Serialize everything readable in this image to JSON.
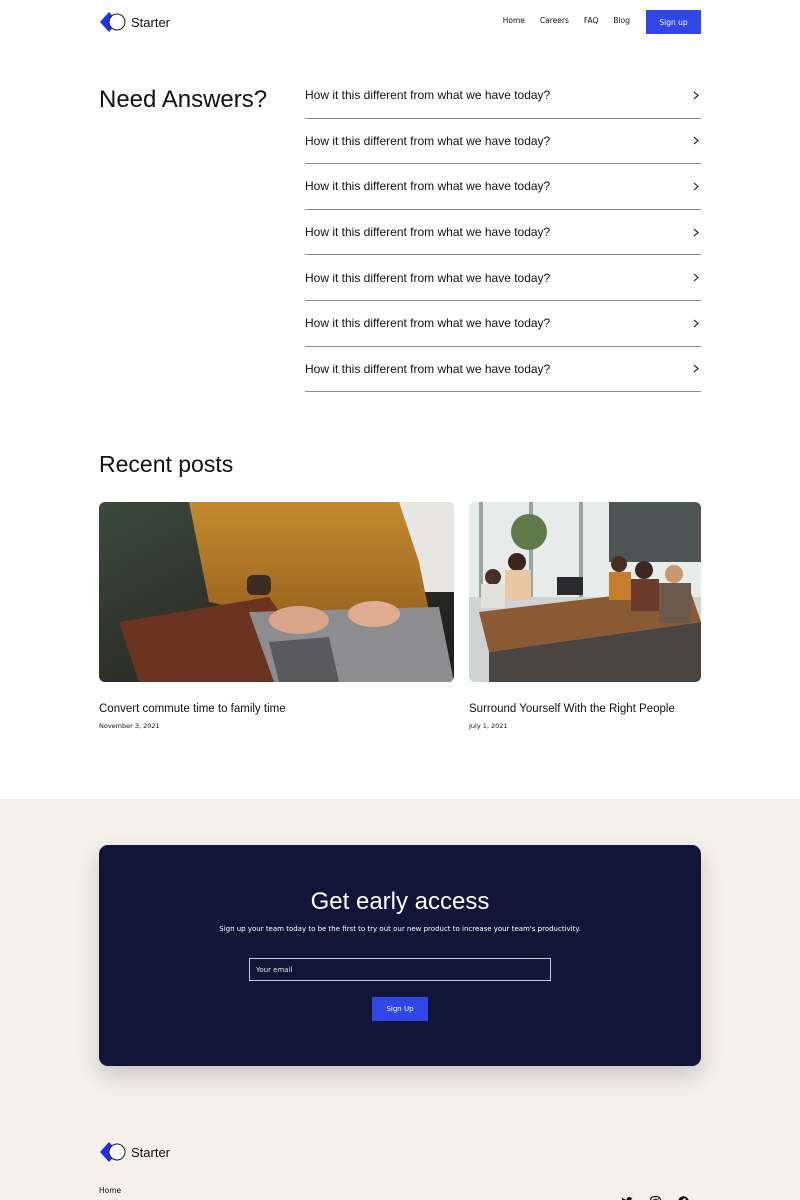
{
  "header": {
    "logo_text": "Starter",
    "nav": [
      "Home",
      "Careers",
      "FAQ",
      "Blog"
    ],
    "signup_label": "Sign up"
  },
  "faq": {
    "title": "Need Answers?",
    "questions": [
      "How it this different from what we have today?",
      "How it this different from what we have today?",
      "How it this different from what we have today?",
      "How it this different from what we have today?",
      "How it this different from what we have today?",
      "How it this different from what we have today?",
      "How it this different from what we have today?"
    ]
  },
  "posts": {
    "title": "Recent posts",
    "items": [
      {
        "title": "Convert commute time to family time",
        "date": "November 3, 2021",
        "image": "person-typing-on-laptop-photo"
      },
      {
        "title": "Surround Yourself With the Right People",
        "date": "July 1, 2021",
        "image": "team-meeting-at-table-photo"
      }
    ]
  },
  "cta": {
    "title": "Get early access",
    "subtitle": "Sign up your team today to be the first to try out our new product to increase your team's productivity.",
    "email_placeholder": "Your email",
    "button_label": "Sign Up"
  },
  "footer": {
    "logo_text": "Starter",
    "home_link": "Home",
    "social_icons": [
      "twitter-icon",
      "instagram-icon",
      "facebook-icon"
    ]
  },
  "colors": {
    "accent": "#3046e8",
    "cta_card": "#111638",
    "band": "#f5f0eb"
  }
}
